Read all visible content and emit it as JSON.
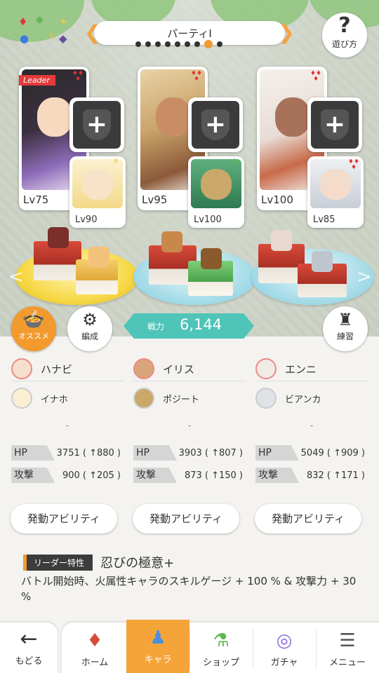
{
  "header": {
    "party_title": "パーティⅠ",
    "help_label": "遊び方",
    "page_dots": 9,
    "active_dot": 7
  },
  "elements": [
    "♦",
    "⚡",
    "✦",
    "◆",
    "●",
    "✸"
  ],
  "party": [
    {
      "leader_badge": "Leader",
      "main": {
        "level": "Lv75",
        "color": "#6b4c9a"
      },
      "sub": {
        "level": "Lv90",
        "color": "#f6e1a8"
      }
    },
    {
      "leader_badge": "",
      "main": {
        "level": "Lv95",
        "color": "#c9a36a"
      },
      "sub": {
        "level": "Lv100",
        "color": "#3b8f5e"
      }
    },
    {
      "leader_badge": "",
      "main": {
        "level": "Lv100",
        "color": "#f0e7e2"
      },
      "sub": {
        "level": "Lv85",
        "color": "#d9dde3"
      }
    }
  ],
  "buttons": {
    "recommend": "オススメ",
    "formation": "編成",
    "practice": "練習"
  },
  "power": {
    "label": "戦力",
    "value": "6,144"
  },
  "members": [
    {
      "name": "ハナビ",
      "sub_name": "イナホ",
      "dash": "-",
      "hp_label": "HP",
      "hp": "3751 ( ↑880 )",
      "atk_label": "攻撃",
      "atk": "900 ( ↑205 )",
      "ability": "発動アビリティ"
    },
    {
      "name": "イリス",
      "sub_name": "ポジート",
      "dash": "-",
      "hp_label": "HP",
      "hp": "3903 ( ↑807 )",
      "atk_label": "攻撃",
      "atk": "873 ( ↑150 )",
      "ability": "発動アビリティ"
    },
    {
      "name": "エンニ",
      "sub_name": "ビアンカ",
      "dash": "-",
      "hp_label": "HP",
      "hp": "5049 ( ↑909 )",
      "atk_label": "攻撃",
      "atk": "832 ( ↑171 )",
      "ability": "発動アビリティ"
    }
  ],
  "leader_skill": {
    "tag": "リーダー特性",
    "name": "忍びの極意+",
    "description": "バトル開始時、火属性キャラのスキルゲージ + 100 % & 攻撃力 + 30 %"
  },
  "nav": {
    "back": "もどる",
    "items": [
      {
        "label": "ホーム",
        "icon": "home-icon"
      },
      {
        "label": "キャラ",
        "icon": "chara-icon"
      },
      {
        "label": "ショップ",
        "icon": "shop-icon"
      },
      {
        "label": "ガチャ",
        "icon": "gacha-icon"
      },
      {
        "label": "メニュー",
        "icon": "menu-icon"
      }
    ],
    "active": "キャラ"
  },
  "colors": {
    "accent": "#f29a2e",
    "power": "#4fc4b8",
    "fire": "#e0333a"
  }
}
